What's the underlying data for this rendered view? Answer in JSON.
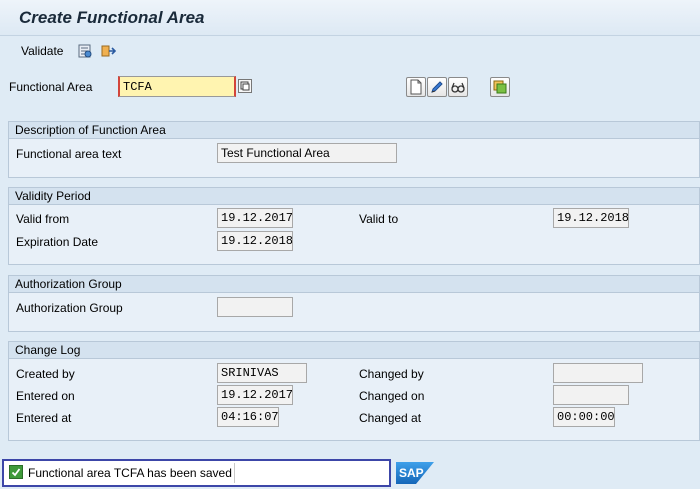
{
  "title": "Create Functional Area",
  "toolbar": {
    "validate_label": "Validate",
    "icons": [
      "configure-icon",
      "navigate-icon"
    ]
  },
  "header_field": {
    "label": "Functional Area",
    "value": "TCFA",
    "tool_icons": [
      "create-document-icon",
      "edit-pencil-icon",
      "display-glasses-icon",
      "copy-icon"
    ]
  },
  "description_group": {
    "title": "Description of Function Area",
    "text_label": "Functional area text",
    "text_value": "Test Functional Area"
  },
  "validity_group": {
    "title": "Validity Period",
    "valid_from_label": "Valid from",
    "valid_from_value": "19.12.2017",
    "valid_to_label": "Valid to",
    "valid_to_value": "19.12.2018",
    "expiration_label": "Expiration Date",
    "expiration_value": "19.12.2018"
  },
  "authorization_group": {
    "title": "Authorization Group",
    "label": "Authorization Group",
    "value": ""
  },
  "change_log": {
    "title": "Change Log",
    "created_by_label": "Created by",
    "created_by_value": "SRINIVAS",
    "entered_on_label": "Entered on",
    "entered_on_value": "19.12.2017",
    "entered_at_label": "Entered at",
    "entered_at_value": "04:16:07",
    "changed_by_label": "Changed by",
    "changed_by_value": "",
    "changed_on_label": "Changed on",
    "changed_on_value": "",
    "changed_at_label": "Changed at",
    "changed_at_value": "00:00:00"
  },
  "status": {
    "message": "Functional area TCFA has been saved",
    "type": "success",
    "logo_text": "SAP"
  },
  "colors": {
    "background": "#dfebf5",
    "input_required": "#fff4b0",
    "status_border": "#3c46a8",
    "success_green": "#3f9a3a",
    "sap_blue": "#1a73c8"
  }
}
